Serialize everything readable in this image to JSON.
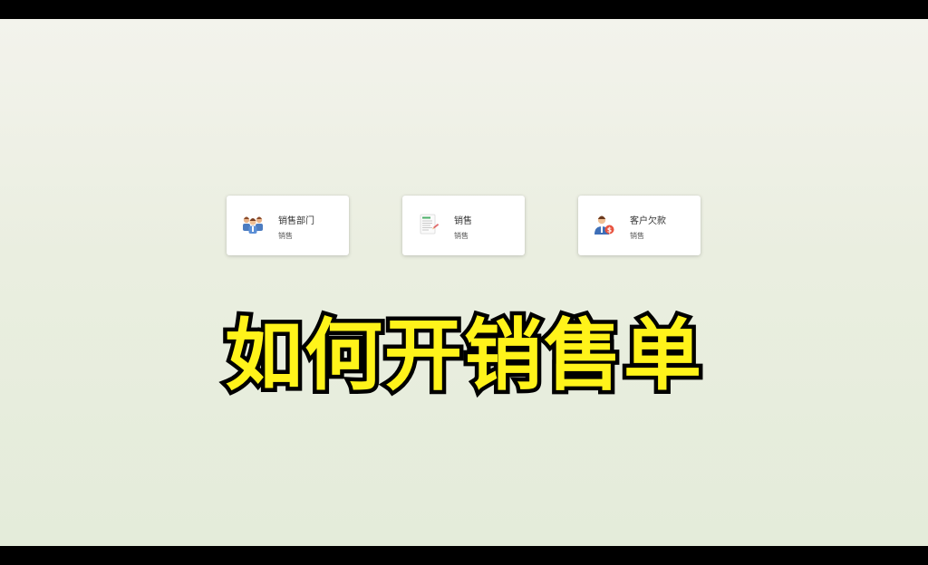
{
  "cards": [
    {
      "title": "销售部门",
      "subtitle": "销售",
      "icon": "team-people-icon"
    },
    {
      "title": "销售",
      "subtitle": "销售",
      "icon": "sales-document-icon"
    },
    {
      "title": "客户欠款",
      "subtitle": "销售",
      "icon": "customer-debt-icon"
    }
  ],
  "caption": "如何开销售单",
  "colors": {
    "caption_fill": "#fff31a",
    "caption_stroke": "#000000",
    "card_background": "#ffffff",
    "letterbox": "#000000"
  }
}
